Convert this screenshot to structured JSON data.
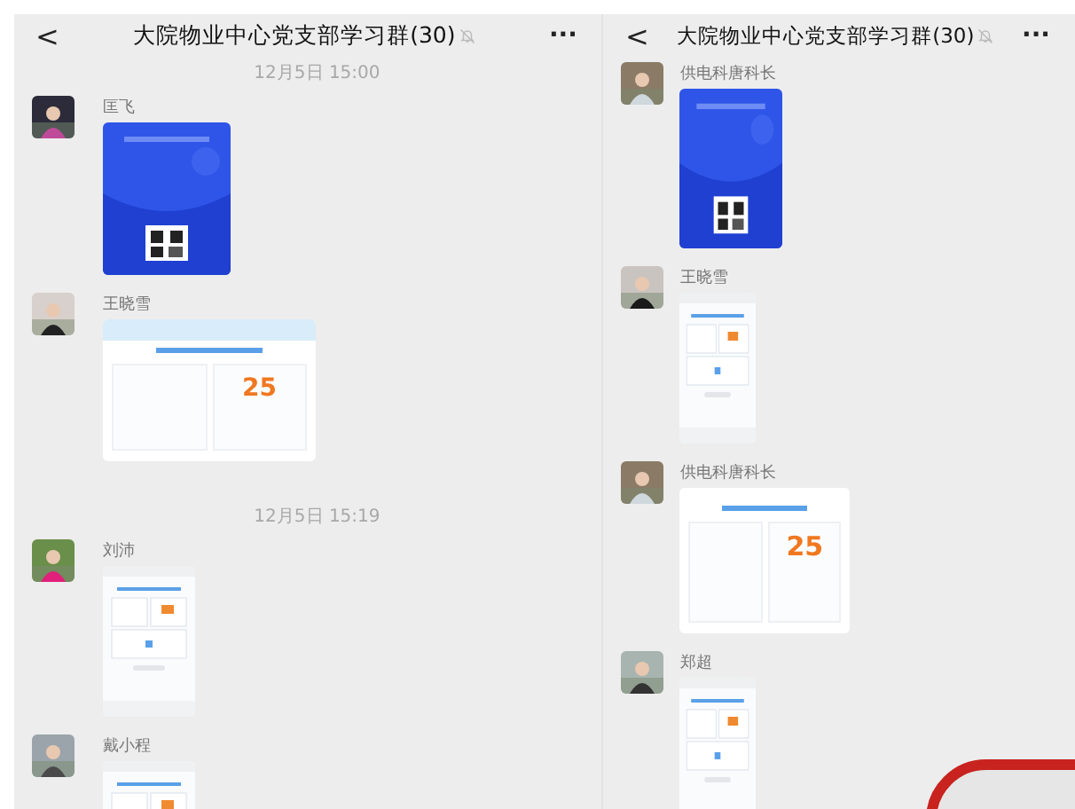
{
  "panes": [
    {
      "header": {
        "back": "<",
        "title": "大院物业中心党支部学习群(30)",
        "more": "···"
      },
      "items": [
        {
          "kind": "time",
          "text": "12月5日 15:00"
        },
        {
          "kind": "message",
          "sender": "匡飞",
          "image": {
            "kind": "poster"
          }
        },
        {
          "kind": "message",
          "sender": "王晓雪",
          "image": {
            "kind": "card",
            "score": "25"
          }
        },
        {
          "kind": "time",
          "text": "12月5日 15:19"
        },
        {
          "kind": "message",
          "sender": "刘沛",
          "image": {
            "kind": "phone"
          }
        },
        {
          "kind": "message",
          "sender": "戴小程",
          "image": {
            "kind": "phone"
          }
        }
      ]
    },
    {
      "header": {
        "back": "<",
        "title": "大院物业中心党支部学习群(30)",
        "more": "···"
      },
      "items": [
        {
          "kind": "message",
          "sender": "供电科唐科长",
          "image": {
            "kind": "poster"
          }
        },
        {
          "kind": "message",
          "sender": "王晓雪",
          "image": {
            "kind": "phone"
          }
        },
        {
          "kind": "message",
          "sender": "供电科唐科长",
          "image": {
            "kind": "card",
            "score": "25"
          }
        },
        {
          "kind": "message",
          "sender": "郑超",
          "image": {
            "kind": "phone"
          }
        }
      ]
    }
  ]
}
